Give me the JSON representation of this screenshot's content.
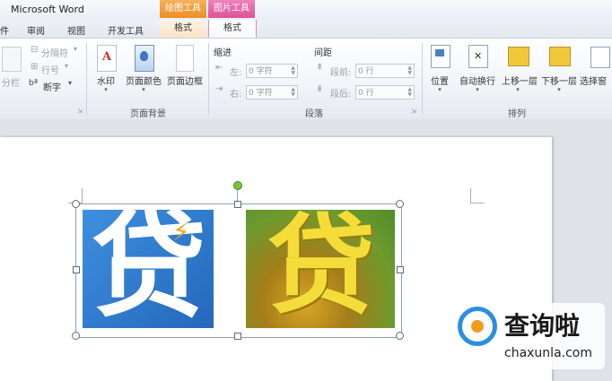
{
  "window": {
    "title": "Microsoft Word"
  },
  "context_groups": [
    {
      "label": "绘图工具",
      "tab": "格式",
      "color": "#f29b37"
    },
    {
      "label": "图片工具",
      "tab": "格式",
      "color": "#e266a6"
    }
  ],
  "tabs": [
    "件",
    "审阅",
    "视图",
    "开发工具"
  ],
  "ribbon": {
    "page_setup": {
      "columns": "分栏",
      "breaks": "分隔符",
      "line_numbers": "行号",
      "hyphenation": "断字"
    },
    "page_background": {
      "label": "页面背景",
      "watermark": "水印",
      "page_color": "页面颜色",
      "page_borders": "页面边框"
    },
    "paragraph": {
      "label": "段落",
      "indent_header": "缩进",
      "indent_left": "左:",
      "indent_left_value": "0 字符",
      "indent_right": "右:",
      "indent_right_value": "0 字符",
      "spacing_header": "间距",
      "spacing_before": "段前:",
      "spacing_before_value": "0 行",
      "spacing_after": "段后:",
      "spacing_after_value": "0 行"
    },
    "arrange": {
      "label": "排列",
      "position": "位置",
      "wrap_text": "自动换行",
      "bring_forward": "上移一层",
      "send_backward": "下移一层",
      "selection_pane": "选择窗"
    }
  },
  "document": {
    "image_left_char": "贷",
    "image_right_char": "贷",
    "colors": {
      "blue": "#2a74c8",
      "gold": "#f2d21a",
      "green": "#7fb43a"
    }
  },
  "watermark": {
    "brand": "查询啦",
    "domain": "chaxunla.com"
  }
}
